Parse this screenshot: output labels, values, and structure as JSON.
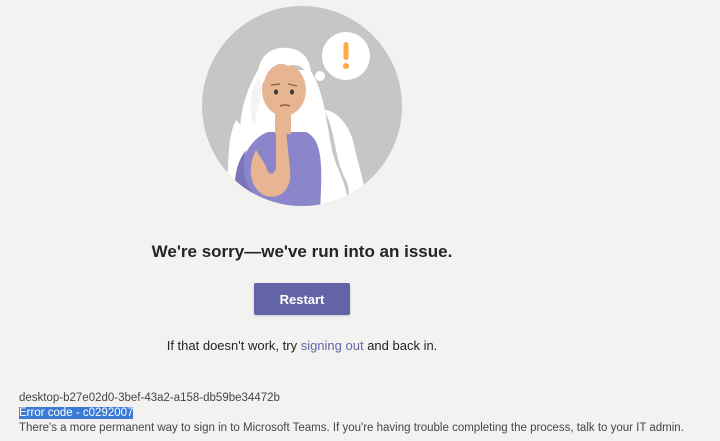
{
  "error": {
    "headline": "We're sorry—we've run into an issue.",
    "restart_label": "Restart",
    "hint_prefix": "If that doesn't work, try ",
    "hint_link": "signing out",
    "hint_suffix": " and back in."
  },
  "footer": {
    "device_id": "desktop-b27e02d0-3bef-43a2-a158-db59be34472b",
    "error_code": "Error code - c0292007",
    "info": "There's a more permanent way to sign in to Microsoft Teams. If you're having trouble completing the process, talk to your IT admin."
  },
  "colors": {
    "background": "#f3f2f1",
    "accent": "#6264a7",
    "illustration_circle": "#c8c6c4",
    "alert_mark": "#ffaa44",
    "selection": "#3a7bd5"
  },
  "icons": {
    "illustration": "confused-person-illustration",
    "alert": "exclamation-alert-icon"
  }
}
